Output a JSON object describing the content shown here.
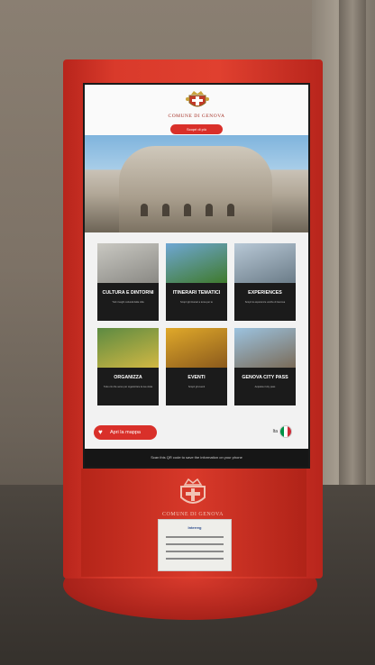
{
  "screen": {
    "header_title": "COMUNE DI GENOVA",
    "top_button": "Scopri di più",
    "tiles": [
      {
        "label": "CULTURA E DINTORNI",
        "sub": "Tutti i luoghi culturali della città",
        "colors": [
          "#c9c8c2",
          "#8a8984"
        ]
      },
      {
        "label": "ITINERARI TEMATICI",
        "sub": "Scopri gli itinerari a tema per te",
        "colors": [
          "#6fa7d4",
          "#3f7a2c"
        ]
      },
      {
        "label": "EXPERIENCES",
        "sub": "Scopri le esperienze uniche di Genova",
        "colors": [
          "#b8c8d6",
          "#6b7c88"
        ]
      },
      {
        "label": "ORGANIZZA",
        "sub": "Tutto ciò che serve per organizzare la tua visita",
        "colors": [
          "#5c8a42",
          "#d2b843"
        ]
      },
      {
        "label": "EVENTI",
        "sub": "Scopri gli eventi",
        "colors": [
          "#e0a92a",
          "#8b5a1c"
        ]
      },
      {
        "label": "GENOVA CITY PASS",
        "sub": "Acquista il city pass",
        "colors": [
          "#9cc3e0",
          "#7a6b58"
        ]
      }
    ],
    "map_button": "Apri la mappa",
    "language": "Ita",
    "footer_text": "Scan this QR code to save the information on your phone"
  },
  "kiosk": {
    "lower_title": "COMUNE DI GENOVA",
    "plaque_logo": "Interreg"
  },
  "colors": {
    "kiosk_red": "#d93a2b",
    "button_red": "#d9302a",
    "screen_dark": "#1b1b1b"
  }
}
